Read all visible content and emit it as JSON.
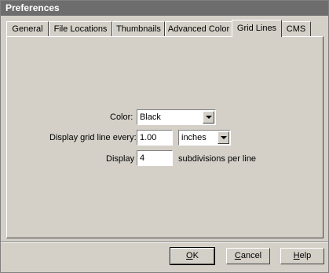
{
  "window": {
    "title": "Preferences"
  },
  "tabs": [
    {
      "label": "General"
    },
    {
      "label": "File Locations"
    },
    {
      "label": "Thumbnails"
    },
    {
      "label": "Advanced Color"
    },
    {
      "label": "Grid Lines",
      "active": true
    },
    {
      "label": "CMS"
    }
  ],
  "form": {
    "color_label": "Color:",
    "color_value": "Black",
    "every_label": "Display grid line every:",
    "every_value": "1.00",
    "unit_value": "inches",
    "display_label": "Display",
    "display_value": "4",
    "display_suffix": "subdivisions per line"
  },
  "buttons": {
    "ok_first": "O",
    "ok_rest": "K",
    "cancel_first": "C",
    "cancel_rest": "ancel",
    "help_first": "H",
    "help_rest": "elp"
  }
}
